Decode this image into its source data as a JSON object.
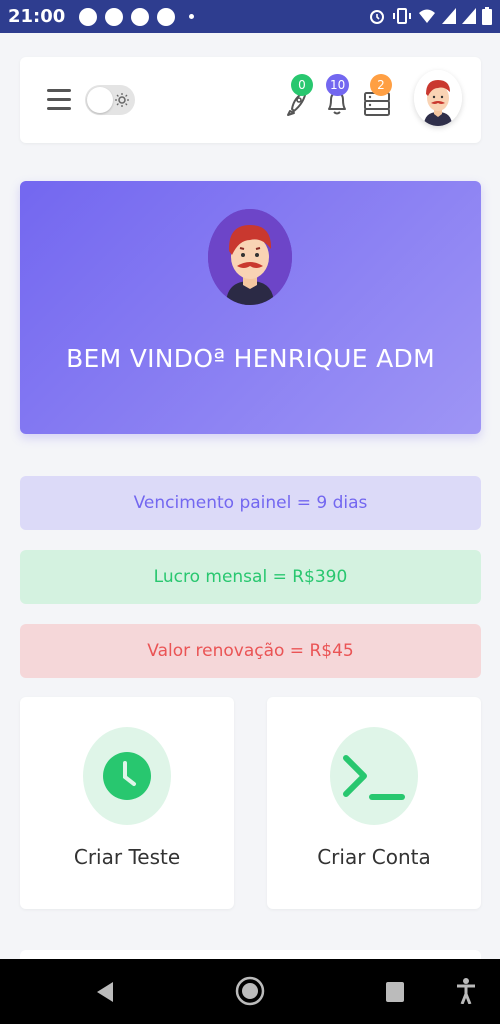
{
  "status_bar": {
    "time": "21:00",
    "left_icons": [
      "telegram-icon",
      "telegram-icon",
      "b-icon",
      "facebook-icon",
      "dot-icon"
    ],
    "right_icons": [
      "alarm-icon",
      "vibrate-icon",
      "wifi-icon",
      "signal-icon",
      "signal-icon",
      "battery-icon"
    ]
  },
  "header": {
    "badges": {
      "rocket": "0",
      "bell": "10",
      "server": "2"
    },
    "badge_colors": {
      "rocket": "#28c76f",
      "bell": "#7367f0",
      "server": "#ff9f43"
    }
  },
  "banner": {
    "welcome_text": "BEM VINDOª HENRIQUE ADM"
  },
  "info": {
    "vencimento": "Vencimento painel = 9 dias",
    "lucro": "Lucro mensal = R$390",
    "renovacao": "Valor renovação = R$45"
  },
  "actions": {
    "criar_teste": "Criar Teste",
    "criar_conta": "Criar Conta"
  },
  "colors": {
    "primary": "#7367f0",
    "success": "#28c76f",
    "danger": "#ea5455",
    "status_bar": "#2e3d8f"
  }
}
